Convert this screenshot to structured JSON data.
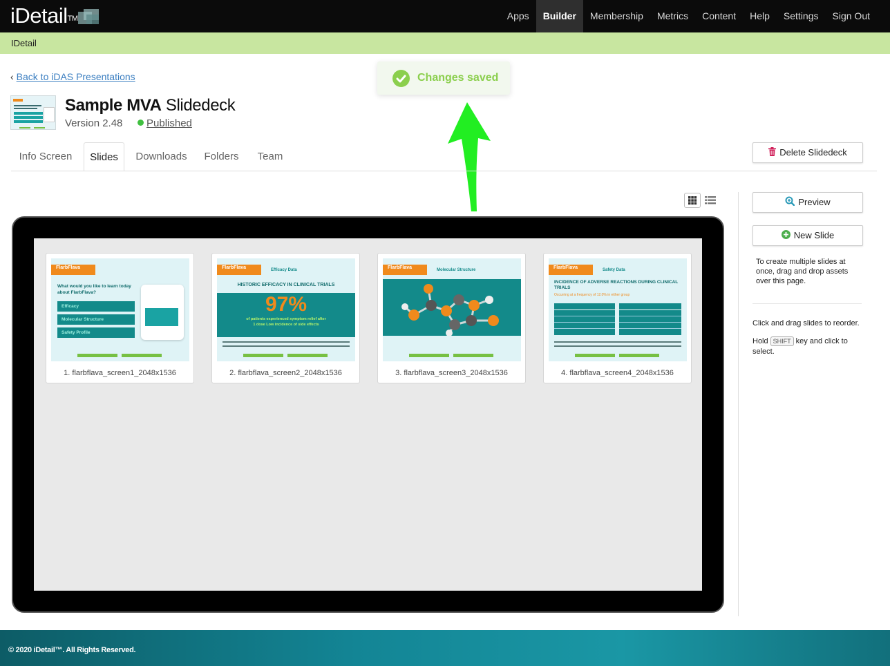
{
  "app": {
    "logo_text": "iDetail",
    "logo_tm": "TM",
    "nav": [
      {
        "label": "Apps",
        "active": false
      },
      {
        "label": "Builder",
        "active": true
      },
      {
        "label": "Membership",
        "active": false
      },
      {
        "label": "Metrics",
        "active": false
      },
      {
        "label": "Content",
        "active": false
      },
      {
        "label": "Help",
        "active": false
      },
      {
        "label": "Settings",
        "active": false
      },
      {
        "label": "Sign Out",
        "active": false
      }
    ],
    "breadcrumb": "IDetail"
  },
  "back_link": "Back to iDAS Presentations",
  "toast": {
    "message": "Changes saved",
    "icon": "check-circle-icon",
    "color": "#8bcf4d"
  },
  "deck": {
    "title_bold": "Sample MVA",
    "title_rest": "Slidedeck",
    "version": "Version 2.48",
    "status": "Published",
    "status_color": "#40c040"
  },
  "tabs": [
    {
      "label": "Info Screen",
      "active": false
    },
    {
      "label": "Slides",
      "active": true
    },
    {
      "label": "Downloads",
      "active": false
    },
    {
      "label": "Folders",
      "active": false
    },
    {
      "label": "Team",
      "active": false
    }
  ],
  "actions": {
    "delete": "Delete Slidedeck",
    "preview": "Preview",
    "new_slide": "New Slide"
  },
  "view_toggle": {
    "selected": "grid"
  },
  "sidebar": {
    "create_hint": "To create multiple slides at once, drag and drop assets over this page.",
    "reorder_hint": "Click and drag slides to reorder.",
    "select_hint_pre": "Hold",
    "select_key": "SHIFT",
    "select_hint_post": "key and click to select."
  },
  "slides": [
    {
      "caption": "1. flarbflava_screen1_2048x1536",
      "brand": "FlarbFlava",
      "question": "What would you like to learn today about FlarbFlava?",
      "menu": [
        "Efficacy",
        "Molecular Structure",
        "Safety Profile"
      ]
    },
    {
      "caption": "2. flarbflava_screen2_2048x1536",
      "brand": "FlarbFlava",
      "header": "Efficacy Data",
      "headline": "HISTORIC EFFICACY IN CLINICAL TRIALS",
      "stat": "97%",
      "stat_text": "of patients experienced symptom relief after 1 dose Low incidence of side effects"
    },
    {
      "caption": "3. flarbflava_screen3_2048x1536",
      "brand": "FlarbFlava",
      "header": "Molecular Structure"
    },
    {
      "caption": "4. flarbflava_screen4_2048x1536",
      "brand": "FlarbFlava",
      "header": "Safety Data",
      "headline": "INCIDENCE OF ADVERSE REACTIONS DURING CLINICAL TRIALS",
      "subhead": "Occurring at a frequency of 12.0% in either group"
    }
  ],
  "footer": "© 2020 iDetail™. All Rights Reserved.",
  "colors": {
    "accent_green": "#c8e6a0",
    "link_blue": "#3c7fc1",
    "teal": "#138a8a",
    "orange": "#f08a1c",
    "arrow_green": "#22ee22"
  }
}
